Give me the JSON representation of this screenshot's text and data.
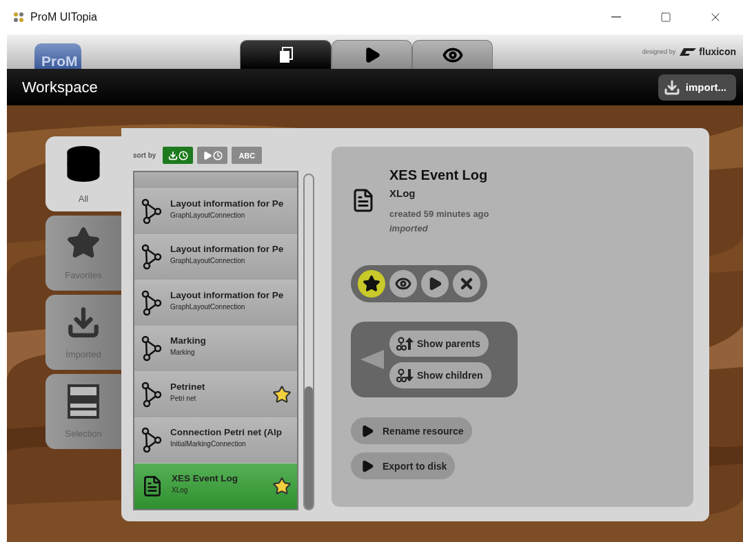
{
  "window": {
    "title": "ProM UITopia"
  },
  "header": {
    "logo": "ProM",
    "tabs": [
      {
        "kind": "workspace",
        "selected": true
      },
      {
        "kind": "action",
        "selected": false
      },
      {
        "kind": "view",
        "selected": false
      }
    ],
    "credit": "designed by",
    "brand": "fluxicon"
  },
  "toolbar": {
    "title": "Workspace",
    "import_button": "import..."
  },
  "nav": [
    {
      "kind": "all",
      "label": "All",
      "selected": true
    },
    {
      "kind": "favorites",
      "label": "Favorites",
      "selected": false
    },
    {
      "kind": "imported",
      "label": "Imported",
      "selected": false
    },
    {
      "kind": "selection",
      "label": "Selection",
      "selected": false
    }
  ],
  "sort": {
    "label": "sort by",
    "options": [
      {
        "kind": "import-time",
        "selected": true
      },
      {
        "kind": "action-time",
        "selected": false
      },
      {
        "kind": "name",
        "label": "ABC",
        "selected": false
      }
    ]
  },
  "resources": [
    {
      "kind": "graph",
      "title": "Layout information for Pe",
      "type": "GraphLayoutConnection",
      "favorite": false,
      "selected": false
    },
    {
      "kind": "graph",
      "title": "Layout information for Pe",
      "type": "GraphLayoutConnection",
      "favorite": false,
      "selected": false
    },
    {
      "kind": "graph",
      "title": "Layout information for Pe",
      "type": "GraphLayoutConnection",
      "favorite": false,
      "selected": false
    },
    {
      "kind": "graph",
      "title": "Marking",
      "type": "Marking",
      "favorite": false,
      "selected": false
    },
    {
      "kind": "graph",
      "title": "Petrinet",
      "type": "Petri net",
      "favorite": true,
      "selected": false
    },
    {
      "kind": "graph",
      "title": "Connection Petri net (Alp",
      "type": "InitialMarkingConnection",
      "favorite": false,
      "selected": false
    },
    {
      "kind": "log",
      "title": "XES Event Log",
      "type": "XLog",
      "favorite": true,
      "selected": true
    }
  ],
  "detail": {
    "title": "XES Event Log",
    "type": "XLog",
    "created": "created 59 minutes ago",
    "origin": "imported",
    "favorite": true,
    "actions": [
      {
        "kind": "view"
      },
      {
        "kind": "run"
      },
      {
        "kind": "delete"
      }
    ],
    "relations": [
      {
        "kind": "parents",
        "label": "Show parents"
      },
      {
        "kind": "children",
        "label": "Show children"
      }
    ],
    "commands": [
      "Rename resource",
      "Export to disk"
    ]
  }
}
